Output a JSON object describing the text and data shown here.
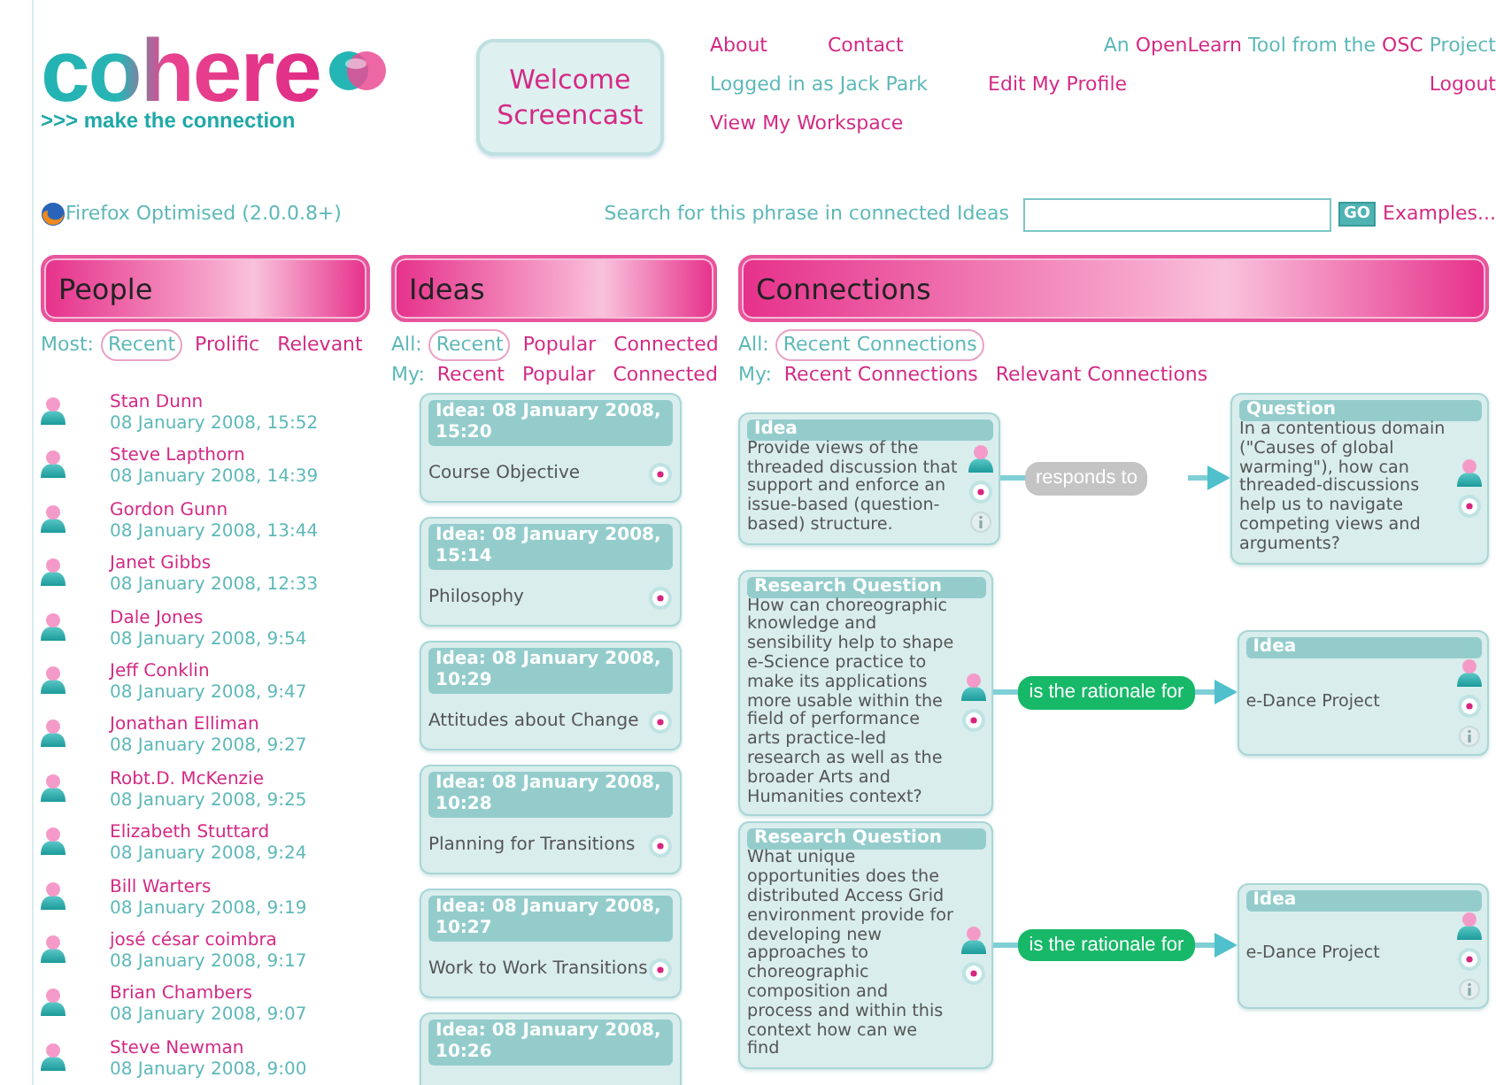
{
  "logo": {
    "title": "cohere",
    "tagline": ">>> make the connection"
  },
  "welcome_button": "Welcome Screencast",
  "nav_rows": [
    {
      "left": [
        {
          "text": "About",
          "kind": "link"
        },
        {
          "text": "Contact",
          "kind": "link"
        }
      ],
      "right": [
        {
          "text": "An ",
          "kind": "text"
        },
        {
          "text": "OpenLearn",
          "kind": "link"
        },
        {
          "text": " Tool from the ",
          "kind": "text"
        },
        {
          "text": "OSC",
          "kind": "link"
        },
        {
          "text": " Project",
          "kind": "text"
        }
      ]
    },
    {
      "left": [
        {
          "text": "Logged in as Jack Park",
          "kind": "text"
        },
        {
          "text": "Edit My Profile",
          "kind": "link"
        }
      ],
      "right": [
        {
          "text": "Logout",
          "kind": "link"
        }
      ]
    },
    {
      "left": [
        {
          "text": "View My Workspace",
          "kind": "link"
        }
      ],
      "right": []
    }
  ],
  "browser_note": "Firefox Optimised (2.0.0.8+)",
  "search": {
    "label": "Search for this phrase in connected Ideas",
    "button": "GO",
    "examples": "Examples..."
  },
  "people": {
    "title": "People",
    "filters": [
      {
        "label": "Most:",
        "options": [
          {
            "label": "Recent",
            "selected": true
          },
          {
            "label": "Prolific",
            "selected": false
          },
          {
            "label": "Relevant",
            "selected": false
          }
        ]
      }
    ],
    "items": [
      {
        "name": "Stan Dunn",
        "date": "08 January 2008, 15:52"
      },
      {
        "name": "Steve Lapthorn",
        "date": "08 January 2008, 14:39"
      },
      {
        "name": "Gordon Gunn",
        "date": "08 January 2008, 13:44"
      },
      {
        "name": "Janet Gibbs",
        "date": "08 January 2008, 12:33"
      },
      {
        "name": "Dale Jones",
        "date": "08 January 2008, 9:54"
      },
      {
        "name": "Jeff Conklin",
        "date": "08 January 2008, 9:47"
      },
      {
        "name": "Jonathan Elliman",
        "date": "08 January 2008, 9:27"
      },
      {
        "name": "Robt.D. McKenzie",
        "date": "08 January 2008, 9:25"
      },
      {
        "name": "Elizabeth Stuttard",
        "date": "08 January 2008, 9:24"
      },
      {
        "name": "Bill Warters",
        "date": "08 January 2008, 9:19"
      },
      {
        "name": "josé césar coimbra",
        "date": "08 January 2008, 9:17"
      },
      {
        "name": "Brian Chambers",
        "date": "08 January 2008, 9:07"
      },
      {
        "name": "Steve Newman",
        "date": "08 January 2008, 9:00"
      }
    ]
  },
  "ideas": {
    "title": "Ideas",
    "filters": [
      {
        "label": "All:",
        "options": [
          {
            "label": "Recent",
            "selected": true
          },
          {
            "label": "Popular",
            "selected": false
          },
          {
            "label": "Connected",
            "selected": false
          }
        ]
      },
      {
        "label": "My:",
        "options": [
          {
            "label": "Recent",
            "selected": false
          },
          {
            "label": "Popular",
            "selected": false
          },
          {
            "label": "Connected",
            "selected": false
          }
        ]
      }
    ],
    "items": [
      {
        "title": "Idea: 08 January 2008, 15:20",
        "text": "Course Objective"
      },
      {
        "title": "Idea: 08 January 2008, 15:14",
        "text": "Philosophy"
      },
      {
        "title": "Idea: 08 January 2008, 10:29",
        "text": "Attitudes about Change"
      },
      {
        "title": "Idea: 08 January 2008, 10:28",
        "text": "Planning for Transitions"
      },
      {
        "title": "Idea: 08 January 2008, 10:27",
        "text": "Work to Work Transitions"
      },
      {
        "title": "Idea: 08 January 2008, 10:26"
      }
    ]
  },
  "connections": {
    "title": "Connections",
    "filters": [
      {
        "label": "All:",
        "options": [
          {
            "label": "Recent Connections",
            "selected": true
          }
        ]
      },
      {
        "label": "My:",
        "options": [
          {
            "label": "Recent Connections",
            "selected": false
          },
          {
            "label": "Relevant Connections",
            "selected": false
          }
        ]
      }
    ],
    "items": [
      {
        "from": {
          "type": "Idea",
          "text": "Provide views of the threaded discussion that support and enforce an issue-based (question-based) structure.",
          "info": true
        },
        "link": {
          "label": "responds to",
          "color": "#c4c4c4"
        },
        "to": {
          "type": "Question",
          "text": "In a contentious domain (\"Causes of global warming\"), how can threaded-discussions help us to navigate competing views and arguments?",
          "info": false
        }
      },
      {
        "from": {
          "type": "Research Question",
          "text": "How can choreographic knowledge and sensibility help to shape e-Science practice to make its applications more usable within the field of performance arts practice-led research as well as the broader Arts and Humanities context?",
          "info": false
        },
        "link": {
          "label": "is the rationale for",
          "color": "#17b868"
        },
        "to": {
          "type": "Idea",
          "text": "e-Dance Project",
          "info": true
        }
      },
      {
        "from": {
          "type": "Research Question",
          "text": "What unique opportunities does the distributed Access Grid environment provide for developing new approaches to choreographic composition and process and within this context how can we find",
          "info": false
        },
        "link": {
          "label": "is the rationale for",
          "color": "#17b868"
        },
        "to": {
          "type": "Idea",
          "text": "e-Dance Project",
          "info": true
        }
      }
    ]
  }
}
